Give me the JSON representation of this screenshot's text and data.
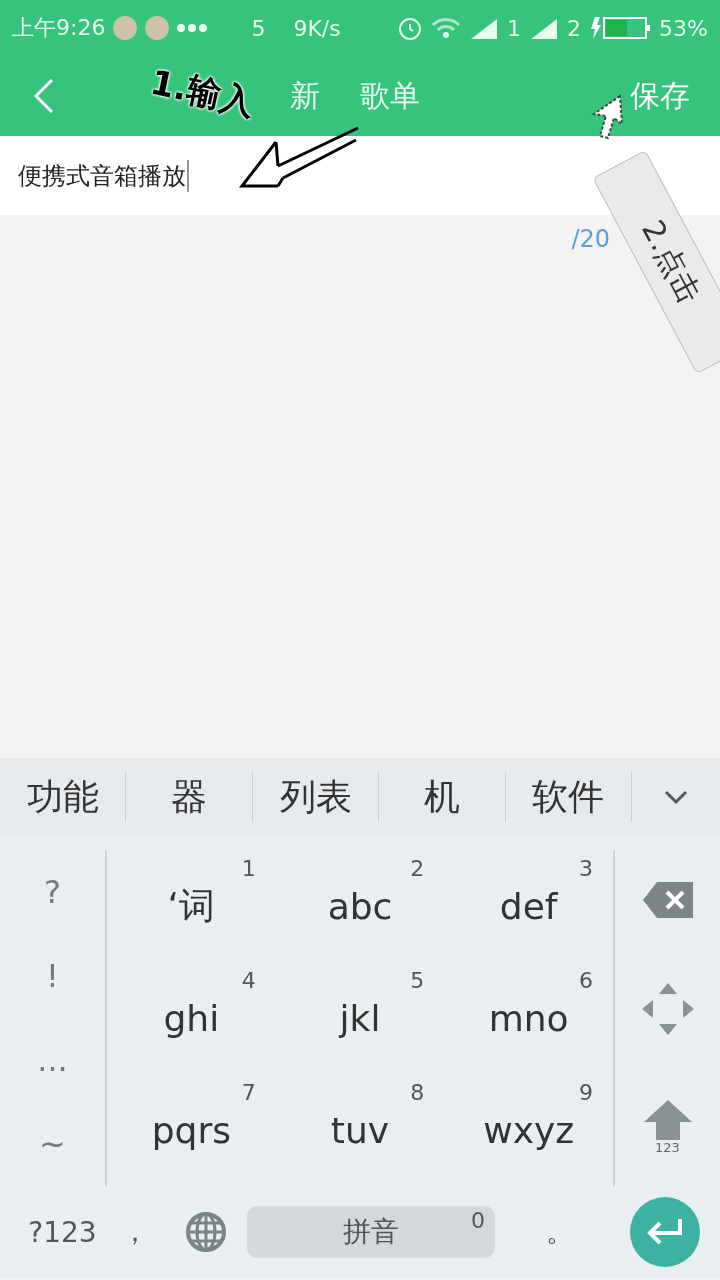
{
  "status_bar": {
    "time": "上午9:26",
    "speed_parts": [
      "5",
      "9K/s"
    ],
    "sims": [
      "1",
      "2"
    ],
    "battery": "53%"
  },
  "header": {
    "title_parts": [
      "新",
      "歌单"
    ],
    "save": "保存"
  },
  "name_field": {
    "value": "便携式音箱播放"
  },
  "counter": "/20",
  "candidates": [
    "功能",
    "器",
    "列表",
    "机",
    "软件"
  ],
  "symbols": [
    "?",
    "!",
    "...",
    "~"
  ],
  "keys": [
    {
      "letters": "‘词",
      "digit": "1"
    },
    {
      "letters": "abc",
      "digit": "2"
    },
    {
      "letters": "def",
      "digit": "3"
    },
    {
      "letters": "ghi",
      "digit": "4"
    },
    {
      "letters": "jkl",
      "digit": "5"
    },
    {
      "letters": "mno",
      "digit": "6"
    },
    {
      "letters": "pqrs",
      "digit": "7"
    },
    {
      "letters": "tuv",
      "digit": "8"
    },
    {
      "letters": "wxyz",
      "digit": "9"
    }
  ],
  "shift_label": "123",
  "bottom_row": {
    "mode": "?123",
    "comma": "，",
    "space": "拼音",
    "space_hint": "0",
    "period": "。"
  },
  "annotations": [
    {
      "text": "1.输入"
    },
    {
      "text": "2.点击"
    }
  ]
}
